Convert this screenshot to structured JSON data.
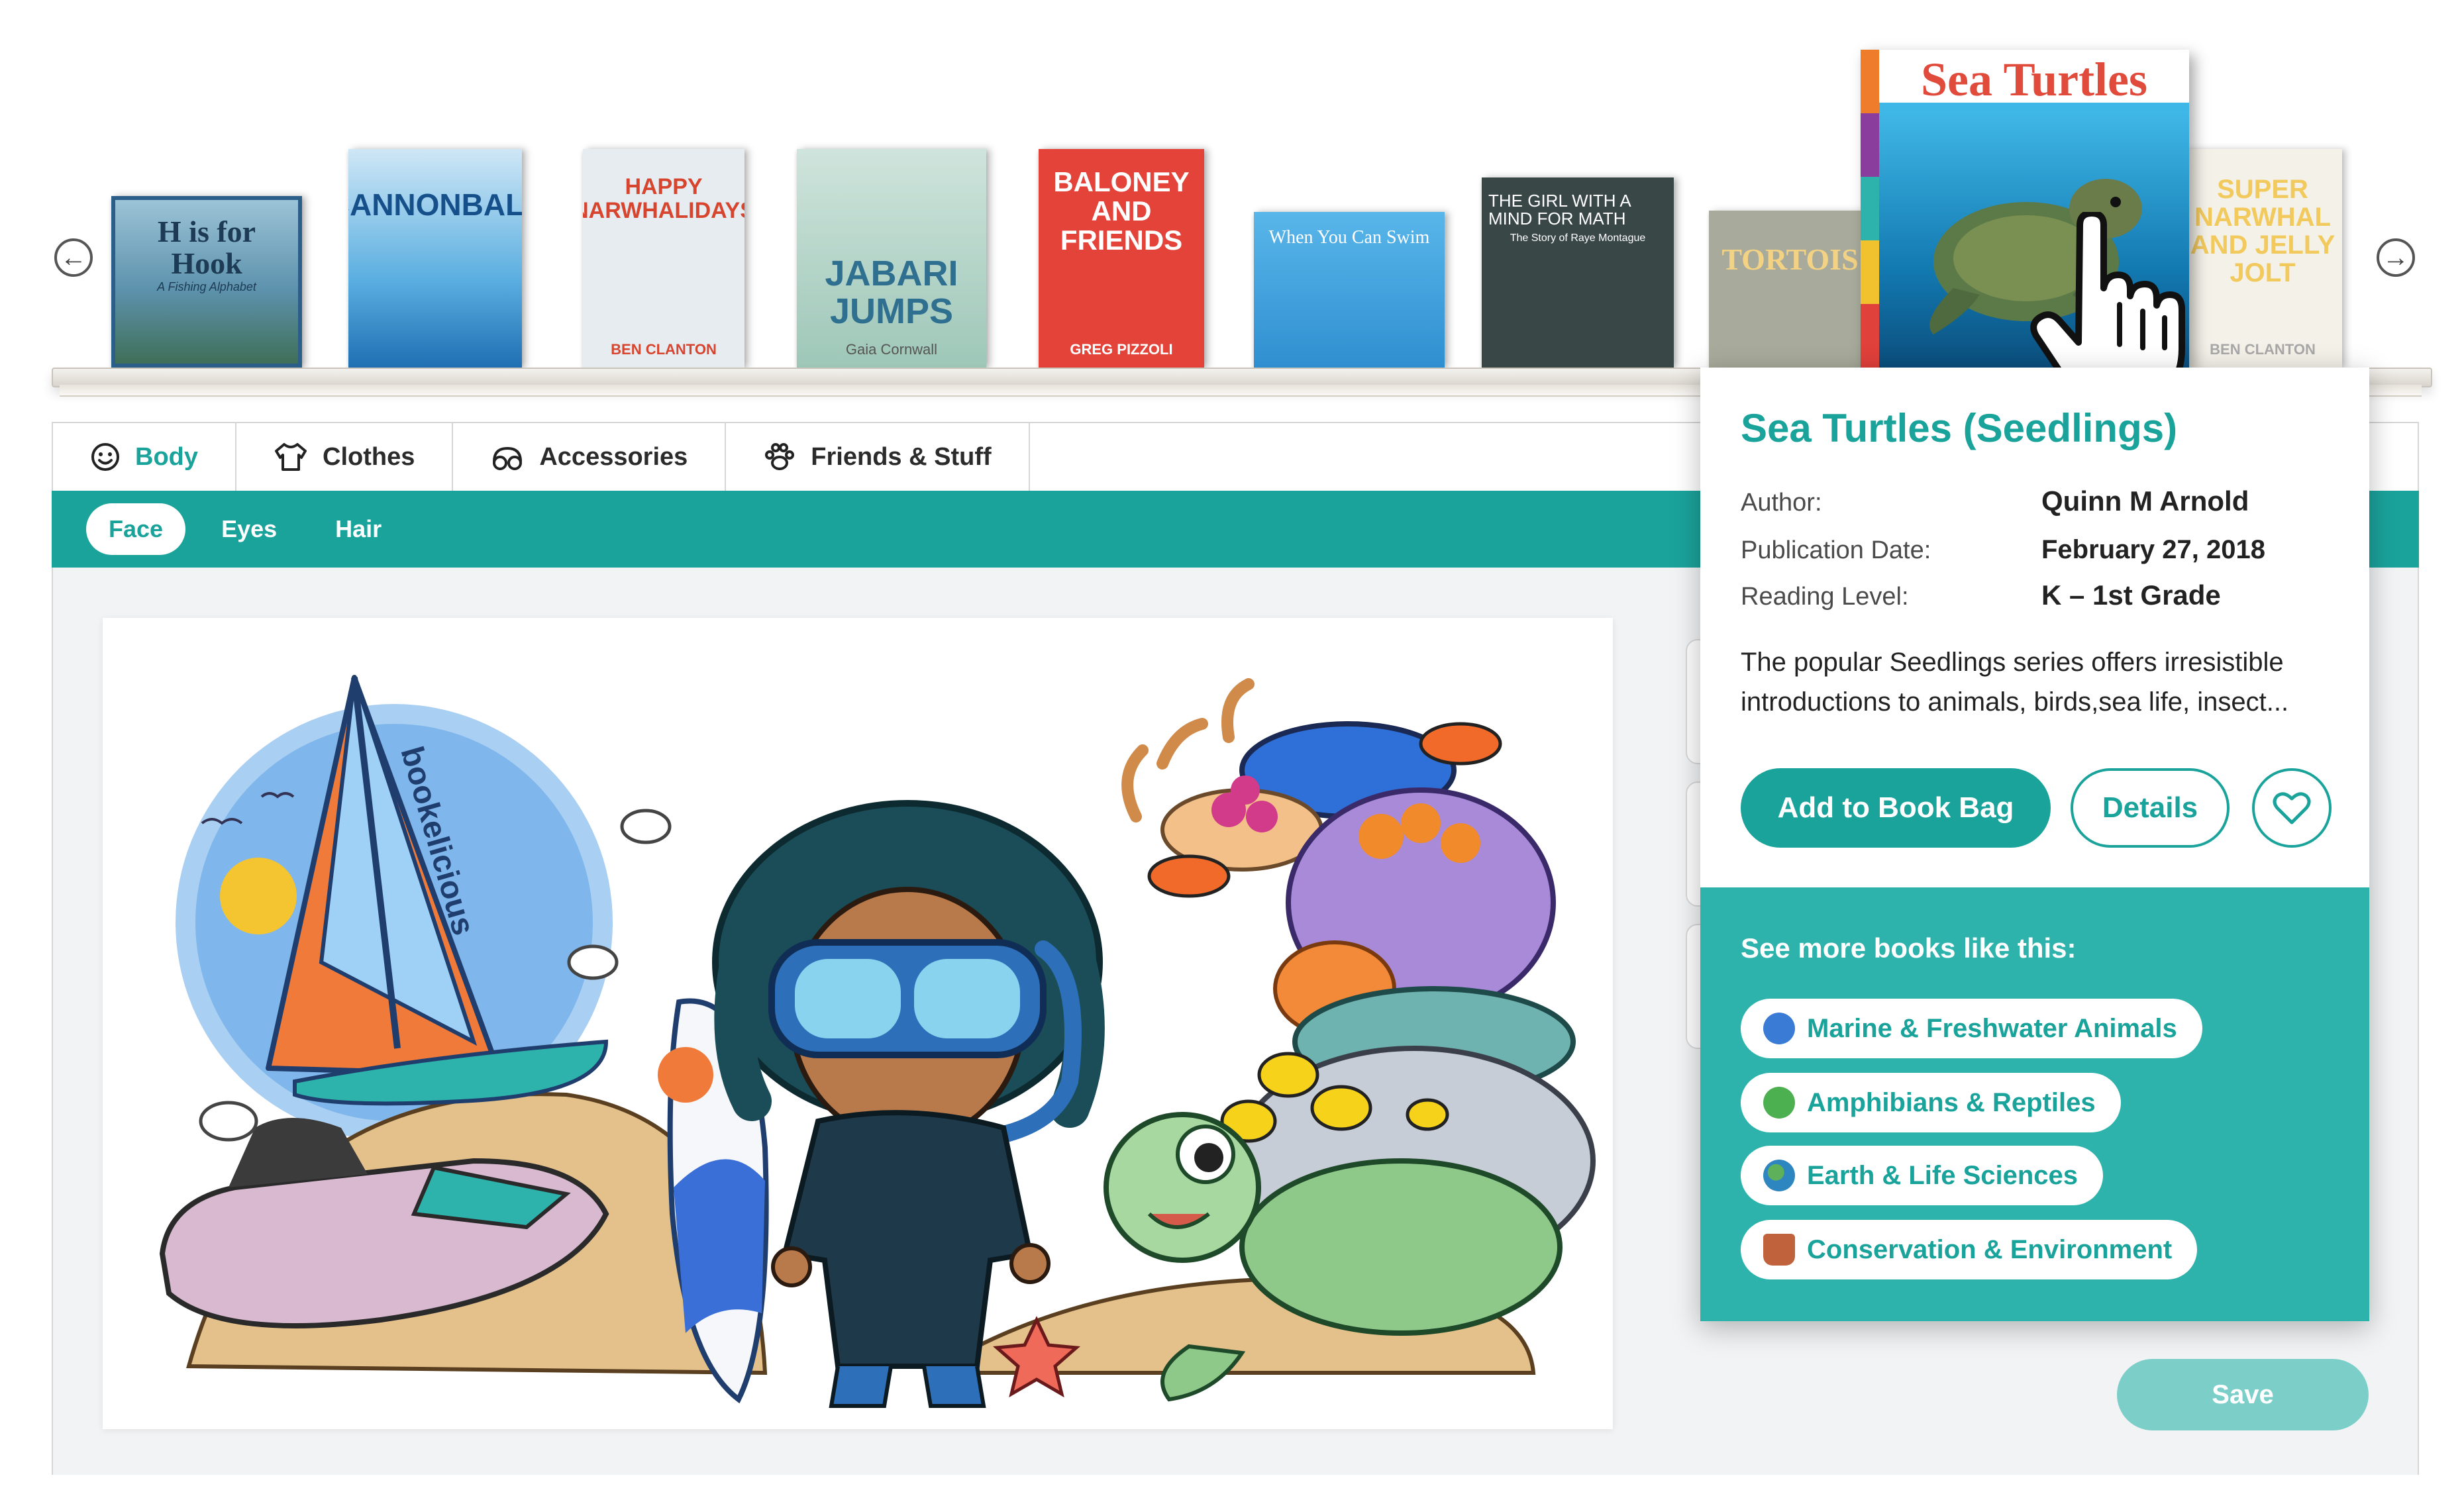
{
  "shelf": {
    "prev_label": "←",
    "next_label": "→",
    "books": [
      {
        "id": "h-is-for-hook",
        "title": "H is for Hook",
        "subtitle": "A Fishing Alphabet",
        "color": "#4f86a8"
      },
      {
        "id": "cannonball",
        "title": "CANNONBALL",
        "color": "#4ea6d8"
      },
      {
        "id": "happy-narwhalidays",
        "title": "HAPPY NARWHALIDAYS",
        "author": "BEN CLANTON",
        "color": "#e9eef2"
      },
      {
        "id": "jabari-jumps",
        "title": "JABARI JUMPS",
        "author": "Gaia Cornwall",
        "color": "#b8d3c8"
      },
      {
        "id": "baloney-and-friends",
        "title": "BALONEY AND FRIENDS",
        "author": "GREG PIZZOLI",
        "color": "#e2463c"
      },
      {
        "id": "when-you-can-swim",
        "title": "When You Can Swim",
        "color": "#3f9ed8"
      },
      {
        "id": "girl-mind-for-math",
        "title": "THE GIRL WITH A MIND FOR MATH",
        "subtitle": "The Story of Raye Montague",
        "color": "#3b4a4a"
      },
      {
        "id": "tortoise",
        "title": "TORTOIS",
        "color": "#8a8f78"
      },
      {
        "id": "sea-turtles",
        "title": "Sea Turtles",
        "color": "#1b8ec2"
      },
      {
        "id": "super-narwhal",
        "title": "SUPER NARWHAL AND JELLY JOLT",
        "author": "BEN CLANTON",
        "color": "#f2f0e6"
      }
    ]
  },
  "tabs": [
    {
      "label": "Body",
      "icon": "smiley-icon",
      "active": true
    },
    {
      "label": "Clothes",
      "icon": "shirt-icon",
      "active": false
    },
    {
      "label": "Accessories",
      "icon": "goggles-icon",
      "active": false
    },
    {
      "label": "Friends & Stuff",
      "icon": "paw-icon",
      "active": false
    }
  ],
  "subtabs": [
    {
      "label": "Face",
      "active": true
    },
    {
      "label": "Eyes",
      "active": false
    },
    {
      "label": "Hair",
      "active": false
    }
  ],
  "scene": {
    "brand_text": "bookelicious"
  },
  "hidden_tab_glyph": ")",
  "save_label": "Save",
  "popup": {
    "title": "Sea Turtles (Seedlings)",
    "author_label": "Author:",
    "author": "Quinn M Arnold",
    "pubdate_label": "Publication Date:",
    "pubdate": "February 27, 2018",
    "level_label": "Reading Level:",
    "level": "K – 1st Grade",
    "description": "The popular Seedlings series offers irresistible introductions to animals, birds,sea life, insect...",
    "add_label": "Add to Book Bag",
    "details_label": "Details",
    "more_title": "See more books like this:",
    "categories": [
      {
        "label": "Marine & Freshwater Animals",
        "icon": "shark-icon",
        "color": "#3a7bd5"
      },
      {
        "label": "Amphibians & Reptiles",
        "icon": "frog-icon",
        "color": "#4caf50"
      },
      {
        "label": "Earth & Life Sciences",
        "icon": "globe-icon",
        "color": "#2e86c1"
      },
      {
        "label": "Conservation & Environment",
        "icon": "plant-pot-icon",
        "color": "#c0623b"
      }
    ]
  },
  "colors": {
    "accent": "#1aa39b",
    "accent_light": "#2db3ac",
    "save_disabled": "#7ccfc8"
  }
}
